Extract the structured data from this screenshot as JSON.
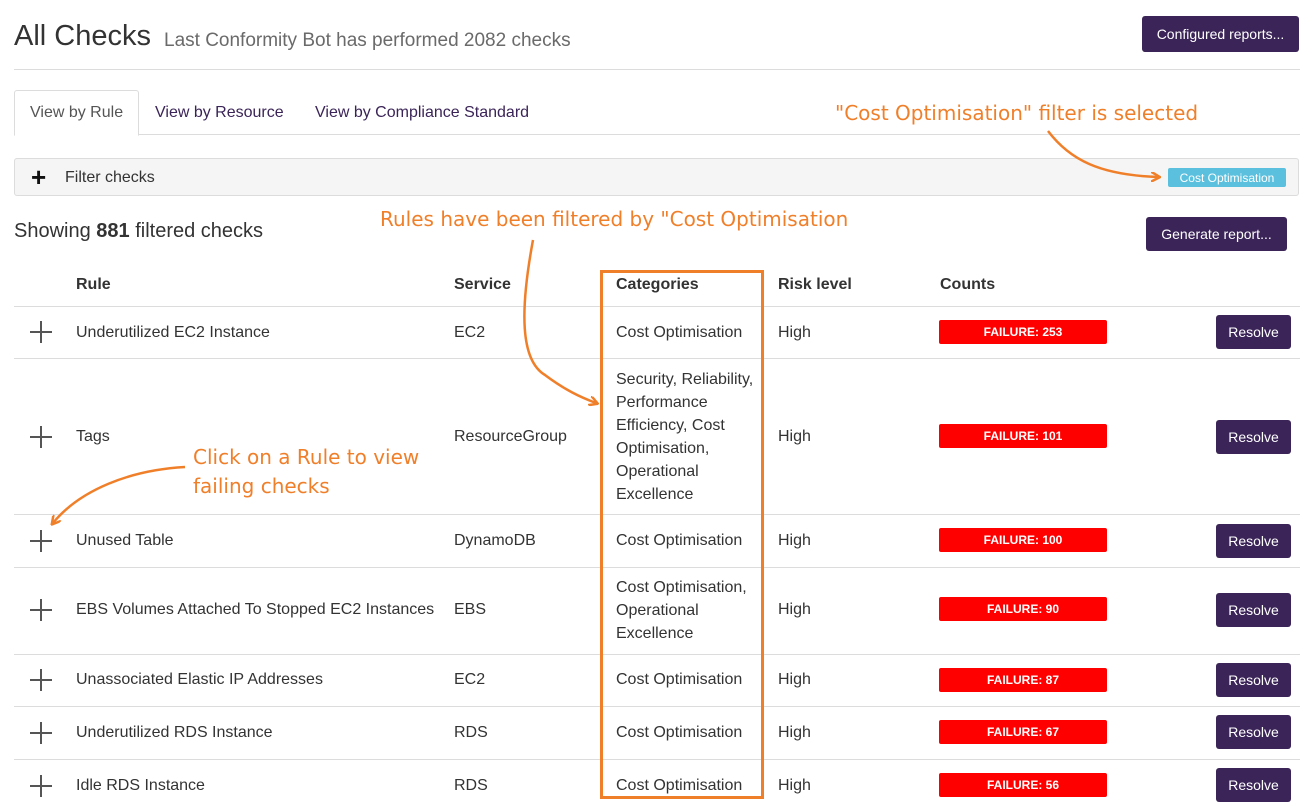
{
  "header": {
    "title": "All Checks",
    "subtitle": "Last Conformity Bot has performed 2082 checks",
    "configured_reports_label": "Configured reports..."
  },
  "tabs": [
    {
      "label": "View by Rule",
      "active": true
    },
    {
      "label": "View by Resource",
      "active": false
    },
    {
      "label": "View by Compliance Standard",
      "active": false
    }
  ],
  "annotations": {
    "filter_selected": "\"Cost Optimisation\" filter is selected",
    "rules_filtered": "Rules have been filtered by \"Cost Optimisation",
    "click_rule_line1": "Click on a Rule to view",
    "click_rule_line2": "failing checks"
  },
  "filter": {
    "label": "Filter checks",
    "active_tag": "Cost Optimisation"
  },
  "summary": {
    "prefix": "Showing",
    "count": "881",
    "suffix": "filtered checks",
    "generate_report_label": "Generate report..."
  },
  "table": {
    "columns": [
      "Rule",
      "Service",
      "Categories",
      "Risk level",
      "Counts"
    ],
    "resolve_label": "Resolve",
    "rows": [
      {
        "rule": "Underutilized EC2 Instance",
        "service": "EC2",
        "categories": [
          "Cost Optimisation"
        ],
        "risk": "High",
        "count": "FAILURE: 253"
      },
      {
        "rule": "Tags",
        "service": "ResourceGroup",
        "categories": [
          "Security, Reliability,",
          "Performance",
          "Efficiency, Cost",
          "Optimisation,",
          "Operational",
          "Excellence"
        ],
        "risk": "High",
        "count": "FAILURE: 101"
      },
      {
        "rule": "Unused Table",
        "service": "DynamoDB",
        "categories": [
          "Cost Optimisation"
        ],
        "risk": "High",
        "count": "FAILURE: 100"
      },
      {
        "rule": "EBS Volumes Attached To Stopped EC2 Instances",
        "service": "EBS",
        "categories": [
          "Cost Optimisation,",
          "Operational",
          "Excellence"
        ],
        "risk": "High",
        "count": "FAILURE: 90"
      },
      {
        "rule": "Unassociated Elastic IP Addresses",
        "service": "EC2",
        "categories": [
          "Cost Optimisation"
        ],
        "risk": "High",
        "count": "FAILURE: 87"
      },
      {
        "rule": "Underutilized RDS Instance",
        "service": "RDS",
        "categories": [
          "Cost Optimisation"
        ],
        "risk": "High",
        "count": "FAILURE: 67"
      },
      {
        "rule": "Idle RDS Instance",
        "service": "RDS",
        "categories": [
          "Cost Optimisation"
        ],
        "risk": "High",
        "count": "FAILURE: 56"
      }
    ]
  },
  "colors": {
    "brand_purple": "#3b2457",
    "failure_red": "#ff0000",
    "annotation_orange": "#f07f2a",
    "filter_tag_blue": "#5bc0de"
  }
}
